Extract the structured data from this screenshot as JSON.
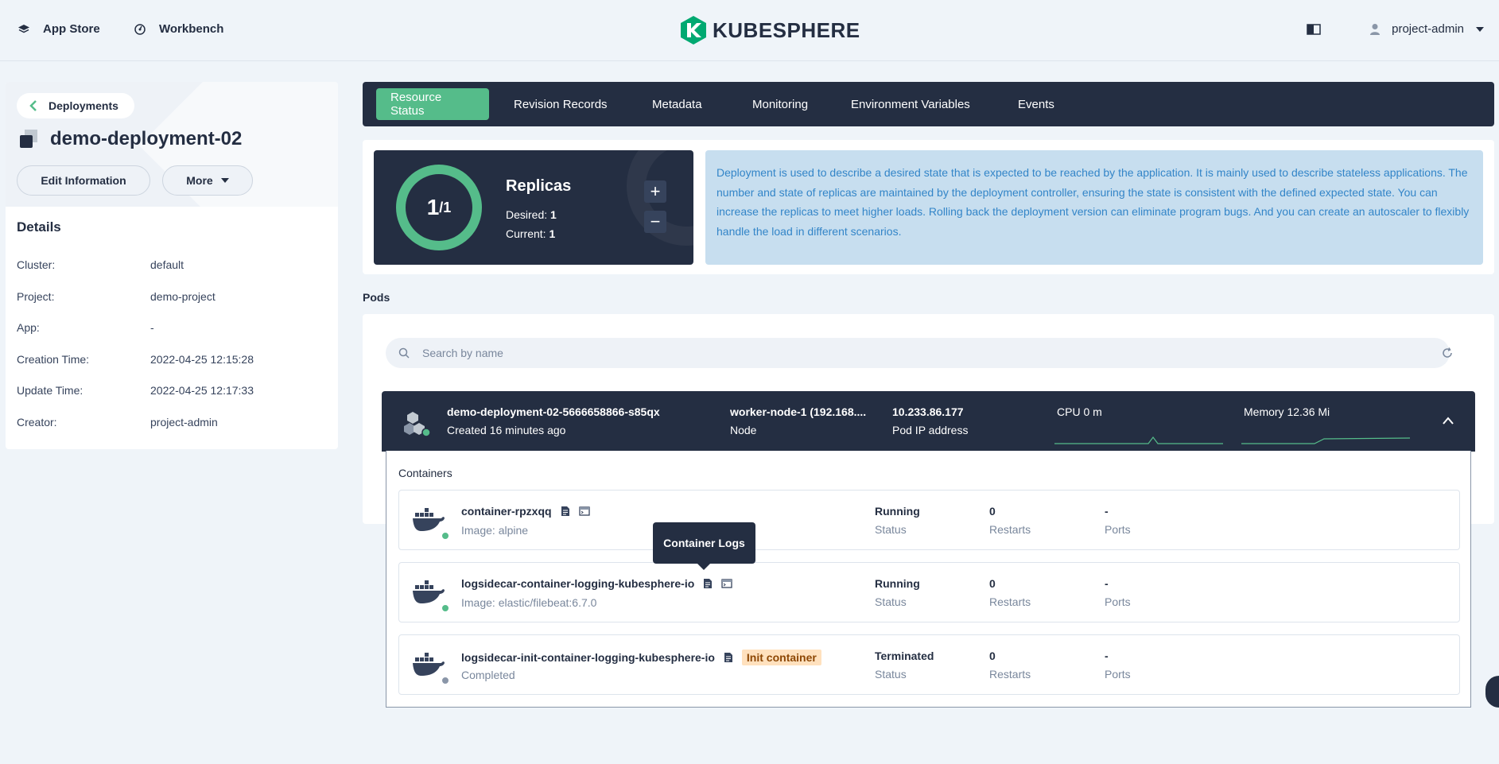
{
  "topnav": {
    "app_store": "App Store",
    "workbench": "Workbench",
    "logo_text": "KUBESPHERE",
    "user": "project-admin"
  },
  "left": {
    "back_label": "Deployments",
    "title": "demo-deployment-02",
    "edit_label": "Edit Information",
    "more_label": "More",
    "details_title": "Details",
    "details": [
      {
        "key": "Cluster:",
        "value": "default"
      },
      {
        "key": "Project:",
        "value": "demo-project"
      },
      {
        "key": "App:",
        "value": "-"
      },
      {
        "key": "Creation Time:",
        "value": "2022-04-25 12:15:28"
      },
      {
        "key": "Update Time:",
        "value": "2022-04-25 12:17:33"
      },
      {
        "key": "Creator:",
        "value": "project-admin"
      }
    ]
  },
  "tabs": [
    {
      "label": "Resource Status",
      "active": true
    },
    {
      "label": "Revision Records"
    },
    {
      "label": "Metadata"
    },
    {
      "label": "Monitoring"
    },
    {
      "label": "Environment Variables"
    },
    {
      "label": "Events"
    }
  ],
  "replicas": {
    "current_num": "1",
    "total": "/1",
    "title": "Replicas",
    "desired_label": "Desired: ",
    "desired": "1",
    "current_label": "Current: ",
    "current": "1"
  },
  "description": "Deployment is used to describe a desired state that is expected to be reached by the application. It is mainly used to describe stateless applications. The number and state of replicas are maintained by the deployment controller, ensuring the state is consistent with the defined expected state. You can increase the replicas to meet higher loads. Rolling back the deployment version can eliminate program bugs. And you can create an autoscaler to flexibly handle the load in different scenarios.",
  "pods": {
    "label": "Pods",
    "search_placeholder": "Search by name",
    "pod": {
      "name": "demo-deployment-02-5666658866-s85qx",
      "created": "Created 16 minutes ago",
      "node": "worker-node-1 (192.168....",
      "node_label": "Node",
      "ip": "10.233.86.177",
      "ip_label": "Pod IP address",
      "cpu": "CPU 0 m",
      "memory": "Memory 12.36 Mi"
    }
  },
  "containers": {
    "label": "Containers",
    "tooltip": "Container Logs",
    "items": [
      {
        "name": "container-rpzxqq",
        "sub": "Image: alpine",
        "status": "Running",
        "status_label": "Status",
        "restarts": "0",
        "restarts_label": "Restarts",
        "ports": "-",
        "ports_label": "Ports",
        "dot_color": "#55bc8a"
      },
      {
        "name": "logsidecar-container-logging-kubesphere-io",
        "sub": "Image: elastic/filebeat:6.7.0",
        "status": "Running",
        "status_label": "Status",
        "restarts": "0",
        "restarts_label": "Restarts",
        "ports": "-",
        "ports_label": "Ports",
        "dot_color": "#55bc8a"
      },
      {
        "name": "logsidecar-init-container-logging-kubesphere-io",
        "sub": "Completed",
        "badge": "Init container",
        "status": "Terminated",
        "status_label": "Status",
        "restarts": "0",
        "restarts_label": "Restarts",
        "ports": "-",
        "ports_label": "Ports",
        "dot_color": "#8a96a8"
      }
    ]
  },
  "colors": {
    "primary": "#242e42",
    "accent": "#55bc8a",
    "info_bg": "#c7deef",
    "info_text": "#3385c8"
  }
}
